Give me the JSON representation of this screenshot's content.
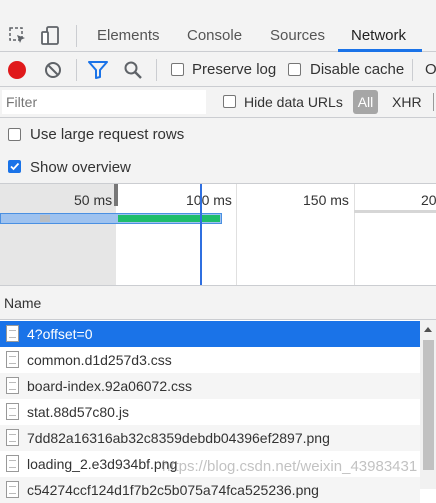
{
  "tabs": [
    {
      "label": "Elements"
    },
    {
      "label": "Console"
    },
    {
      "label": "Sources"
    },
    {
      "label": "Network",
      "active": true
    },
    {
      "label": "O"
    }
  ],
  "toolbar": {
    "preserve_log_label": "Preserve log",
    "disable_cache_label": "Disable cache",
    "record_color": "#e0191b"
  },
  "filterbar": {
    "filter_placeholder": "Filter",
    "hide_data_urls_label": "Hide data URLs",
    "all_label": "All",
    "xhr_label": "XHR"
  },
  "options": {
    "large_rows_label": "Use large request rows",
    "large_rows_checked": false,
    "show_overview_label": "Show overview",
    "show_overview_checked": true
  },
  "overview": {
    "ticks": [
      "50 ms",
      "100 ms",
      "150 ms",
      "20"
    ]
  },
  "list": {
    "column_name": "Name",
    "rows": [
      "4?offset=0",
      "common.d1d257d3.css",
      "board-index.92a06072.css",
      "stat.88d57c80.js",
      "7dd82a16316ab32c8359debdb04396ef2897.png",
      "loading_2.e3d934bf.png",
      "c54274ccf124d1f7b2c5b075a74fca525236.png"
    ],
    "selected_index": 0
  },
  "watermark": "https://blog.csdn.net/weixin_43983431",
  "colors": {
    "accent": "#1a73e8"
  }
}
